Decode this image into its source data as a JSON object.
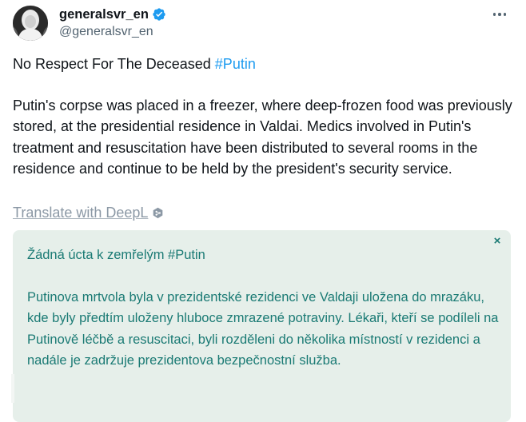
{
  "author": {
    "display_name": "generalsvr_en",
    "handle": "@generalsvr_en",
    "verified": true,
    "avatar_icon": "avatar-photo"
  },
  "menu": {
    "more_icon": "more-horizontal-icon"
  },
  "tweet": {
    "title_text": "No Respect For The Deceased ",
    "hashtag": "#Putin",
    "body": "Putin's corpse was placed in a freezer, where deep-frozen food was previously stored, at the presidential residence in Valdai. Medics involved in Putin's treatment and resuscitation have been distributed to several rooms in the residence and continue to be held by the president's security service."
  },
  "translate": {
    "label": "Translate with DeepL",
    "icon": "deepl-icon"
  },
  "translation": {
    "title": "Žádná úcta k zemřelým #Putin",
    "body": "Putinova mrtvola byla v prezidentské rezidenci ve Valdaji uložena do mrazáku, kde byly předtím uloženy hluboce zmrazené potraviny. Lékaři, kteří se podíleli na Putinově léčbě a resuscitaci, byli rozděleni do několika místností v rezidenci a nadále je zadržuje prezidentova bezpečnostní služba.",
    "close_label": "×"
  },
  "colors": {
    "hashtag": "#1d9bf0",
    "verified": "#1d9bf0",
    "translation_bg": "#e6efea",
    "translation_text": "#1a7a74",
    "secondary_text": "#536471"
  }
}
